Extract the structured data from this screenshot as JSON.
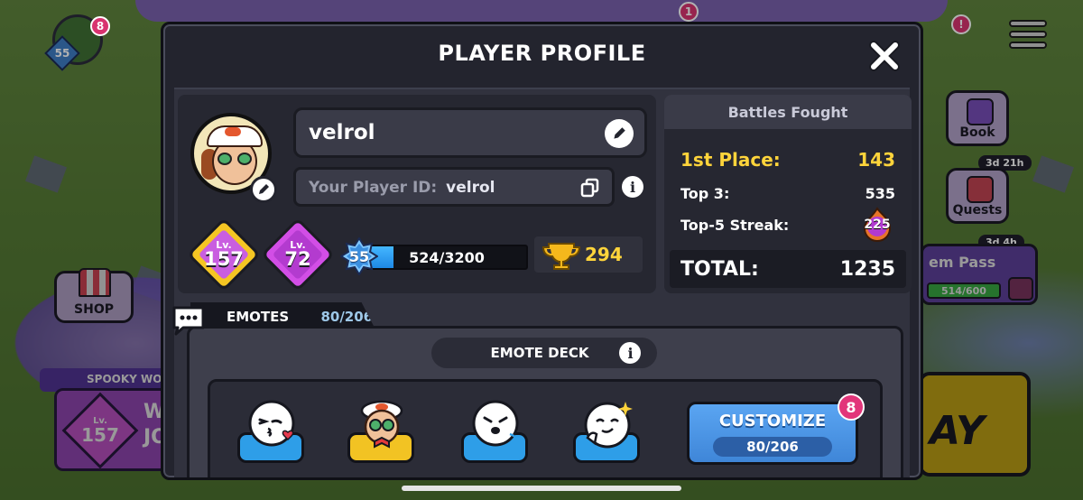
{
  "background": {
    "avatar_badge_level": "55",
    "avatar_badge_count": "8",
    "top_notification_count": "1",
    "right_notification_count": "!",
    "shop_label": "SHOP",
    "spooky_banner": "SPOOKY WO",
    "event_level_label": "Lv.",
    "event_level": "157",
    "event_text_line1": "W",
    "event_text_line2": "JO",
    "book_label": "Book",
    "quests_label": "Quests",
    "quests_timer": "3d 21h",
    "pass_timer": "3d 4h",
    "pass_label": "em Pass",
    "pass_progress": "514/600",
    "play_label": "AY"
  },
  "modal": {
    "title": "PLAYER PROFILE",
    "player_name": "velrol",
    "player_id_label": "Your Player ID:",
    "player_id": "velrol",
    "levels": [
      {
        "label": "Lv.",
        "value": "157",
        "color": "#f5c623",
        "inner": "#c95ee0"
      },
      {
        "label": "Lv.",
        "value": "72",
        "color": "#d24ee6",
        "inner": "#b33bcf"
      }
    ],
    "xp": {
      "level": "55",
      "text": "524/3200",
      "current": 524,
      "max": 3200
    },
    "trophies": "294",
    "battles": {
      "title": "Battles Fought",
      "first_label": "1st Place:",
      "first_value": "143",
      "top3_label": "Top 3:",
      "top3_value": "535",
      "streak_label": "Top-5 Streak:",
      "streak_value": "225",
      "total_label": "TOTAL:",
      "total_value": "1235"
    },
    "emotes": {
      "tab_label": "EMOTES",
      "tab_count": "80/206",
      "deck_label": "EMOTE DECK",
      "customize_label": "CUSTOMIZE",
      "customize_count": "80/206",
      "customize_badge": "8",
      "slots": [
        "kiss-emote",
        "character-emote",
        "pouting-emote",
        "smug-emote"
      ]
    }
  },
  "colors": {
    "modal_bg": "#23242e",
    "accent_gold": "#ffd43b",
    "accent_blue": "#3f86d8",
    "badge_pink": "#e2357a"
  }
}
